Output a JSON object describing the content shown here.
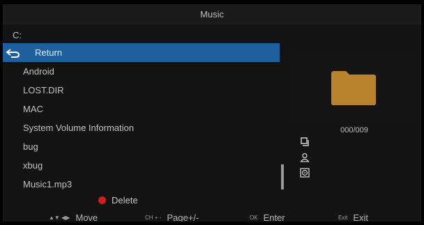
{
  "window": {
    "title": "Music"
  },
  "path": "C:",
  "list": {
    "items": [
      {
        "label": "Return",
        "type": "return",
        "selected": true
      },
      {
        "label": "Android",
        "type": "folder",
        "selected": false
      },
      {
        "label": "LOST.DIR",
        "type": "folder",
        "selected": false
      },
      {
        "label": "MAC",
        "type": "folder",
        "selected": false
      },
      {
        "label": "System Volume Information",
        "type": "folder",
        "selected": false
      },
      {
        "label": "bug",
        "type": "folder",
        "selected": false
      },
      {
        "label": "xbug",
        "type": "folder",
        "selected": false
      },
      {
        "label": "Music1.mp3",
        "type": "file",
        "selected": false
      }
    ]
  },
  "preview": {
    "icon": "folder-icon",
    "count": "000/009",
    "folder_color": "#b9822d"
  },
  "info_icons": [
    "album-icon",
    "artist-icon",
    "disc-icon"
  ],
  "footer": {
    "delete": {
      "label": "Delete",
      "color": "#d41c1c"
    },
    "hints": [
      {
        "key": "▲▼ ◀▶",
        "label": "Move"
      },
      {
        "key": "CH + -",
        "label": "Page+/-"
      },
      {
        "key": "OK",
        "label": "Enter"
      },
      {
        "key": "Exit",
        "label": "Exit"
      }
    ]
  },
  "colors": {
    "selection": "#1e5f9e",
    "background": "#131313"
  }
}
